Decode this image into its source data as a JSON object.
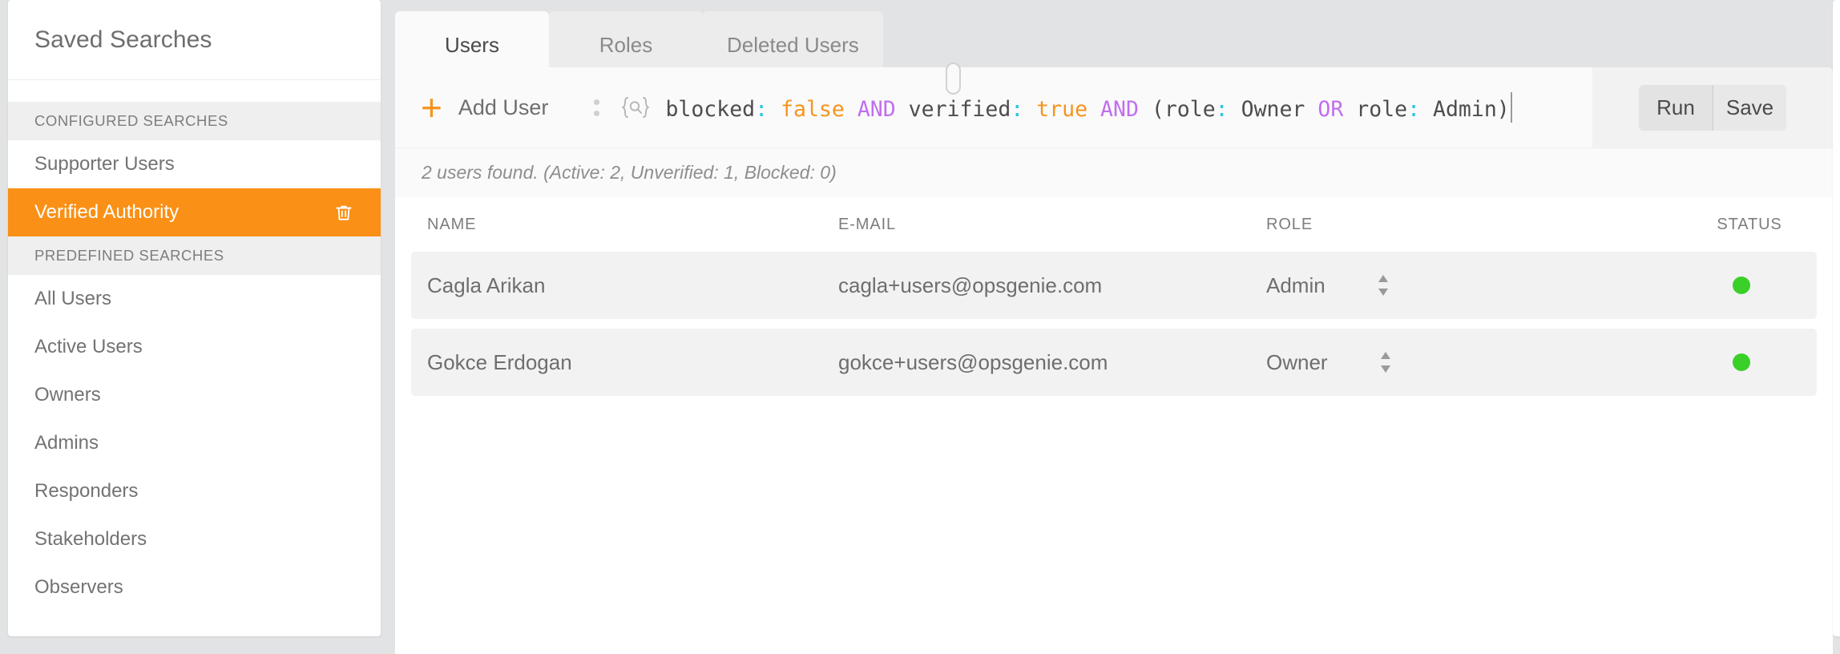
{
  "sidebar": {
    "title": "Saved Searches",
    "sections": [
      {
        "heading": "CONFIGURED SEARCHES",
        "items": [
          {
            "label": "Supporter Users",
            "active": false,
            "deletable": false
          },
          {
            "label": "Verified Authority",
            "active": true,
            "deletable": true
          }
        ]
      },
      {
        "heading": "PREDEFINED SEARCHES",
        "items": [
          {
            "label": "All Users",
            "active": false,
            "deletable": false
          },
          {
            "label": "Active Users",
            "active": false,
            "deletable": false
          },
          {
            "label": "Owners",
            "active": false,
            "deletable": false
          },
          {
            "label": "Admins",
            "active": false,
            "deletable": false
          },
          {
            "label": "Responders",
            "active": false,
            "deletable": false
          },
          {
            "label": "Stakeholders",
            "active": false,
            "deletable": false
          },
          {
            "label": "Observers",
            "active": false,
            "deletable": false
          }
        ]
      }
    ],
    "delete_icon": "trash-icon",
    "active_color": "#fa9016"
  },
  "tabs": [
    {
      "label": "Users",
      "active": true
    },
    {
      "label": "Roles",
      "active": false
    },
    {
      "label": "Deleted Users",
      "active": false
    }
  ],
  "toolbar": {
    "add_user_label": "Add User",
    "add_icon": "plus-icon",
    "drag_handle_icon": "drag-dots-icon",
    "query_icon": "query-braces-search-icon",
    "query_raw": "blocked: false AND verified: true AND (role: Owner OR role: Admin)",
    "query_tokens": [
      {
        "t": "blocked",
        "c": "key"
      },
      {
        "t": ":",
        "c": "colon"
      },
      {
        "t": " ",
        "c": "word"
      },
      {
        "t": "false",
        "c": "val"
      },
      {
        "t": " ",
        "c": "word"
      },
      {
        "t": "AND",
        "c": "op"
      },
      {
        "t": " ",
        "c": "word"
      },
      {
        "t": "verified",
        "c": "key"
      },
      {
        "t": ":",
        "c": "colon"
      },
      {
        "t": " ",
        "c": "word"
      },
      {
        "t": "true",
        "c": "val"
      },
      {
        "t": " ",
        "c": "word"
      },
      {
        "t": "AND",
        "c": "op"
      },
      {
        "t": " (",
        "c": "paren"
      },
      {
        "t": "role",
        "c": "key"
      },
      {
        "t": ":",
        "c": "colon"
      },
      {
        "t": " Owner ",
        "c": "word"
      },
      {
        "t": "OR",
        "c": "op"
      },
      {
        "t": " ",
        "c": "word"
      },
      {
        "t": "role",
        "c": "key"
      },
      {
        "t": ":",
        "c": "colon"
      },
      {
        "t": " Admin)",
        "c": "word"
      }
    ],
    "run_label": "Run",
    "save_label": "Save",
    "colors": {
      "key": "#4d4d4d",
      "colon": "#29c5e6",
      "value": "#f7941e",
      "operator": "#c06ef0",
      "accent": "#f7941e"
    }
  },
  "results": {
    "summary": "2 users found. (Active: 2, Unverified: 1, Blocked: 0)",
    "count": 2,
    "active": 2,
    "unverified": 1,
    "blocked": 0
  },
  "table": {
    "columns": [
      "NAME",
      "E-MAIL",
      "ROLE",
      "STATUS"
    ],
    "rows": [
      {
        "name": "Cagla Arikan",
        "email": "cagla+users@opsgenie.com",
        "role": "Admin",
        "status": "active",
        "status_color": "#3ad029"
      },
      {
        "name": "Gokce Erdogan",
        "email": "gokce+users@opsgenie.com",
        "role": "Owner",
        "status": "active",
        "status_color": "#3ad029"
      }
    ]
  }
}
